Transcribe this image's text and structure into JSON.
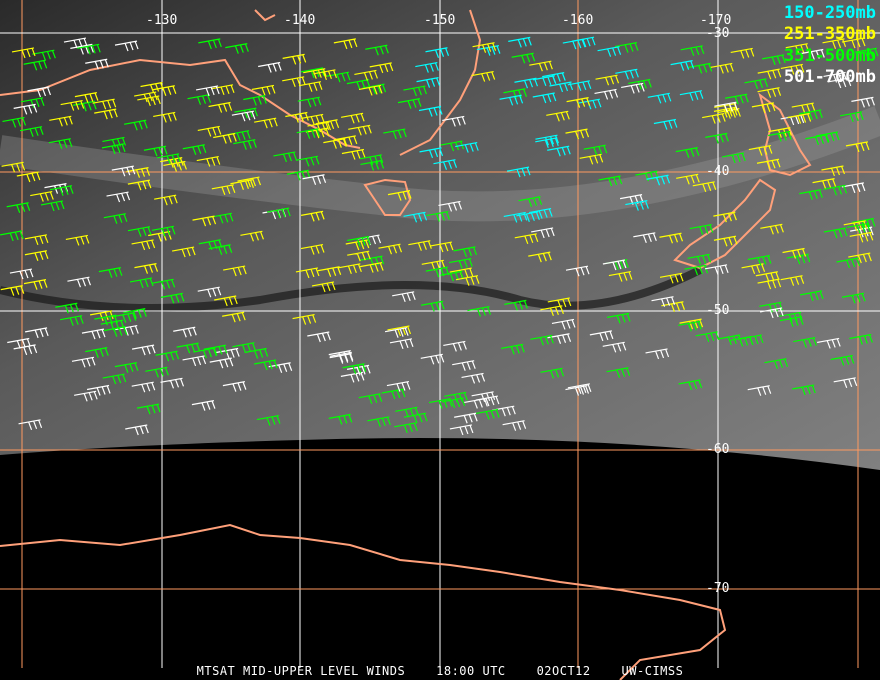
{
  "legend": [
    {
      "label": "150-250mb",
      "color": "#00ffff"
    },
    {
      "label": "251-350mb",
      "color": "#ffff00"
    },
    {
      "label": "351-500mb",
      "color": "#00ff00"
    },
    {
      "label": "501-700mb",
      "color": "#ffffff"
    }
  ],
  "longitude_labels": [
    "-130",
    "-140",
    "-150",
    "-160",
    "-170"
  ],
  "latitude_labels": [
    "-30",
    "-40",
    "-50",
    "-60",
    "-70"
  ],
  "caption": {
    "product": "MTSAT MID-UPPER LEVEL WINDS",
    "time": "18:00 UTC",
    "date": "02OCT12",
    "source": "UW-CIMSS"
  },
  "colors": {
    "coast": "#ffa07a",
    "grid_orange": "#ff9a60",
    "grid_white": "#ffffff"
  }
}
